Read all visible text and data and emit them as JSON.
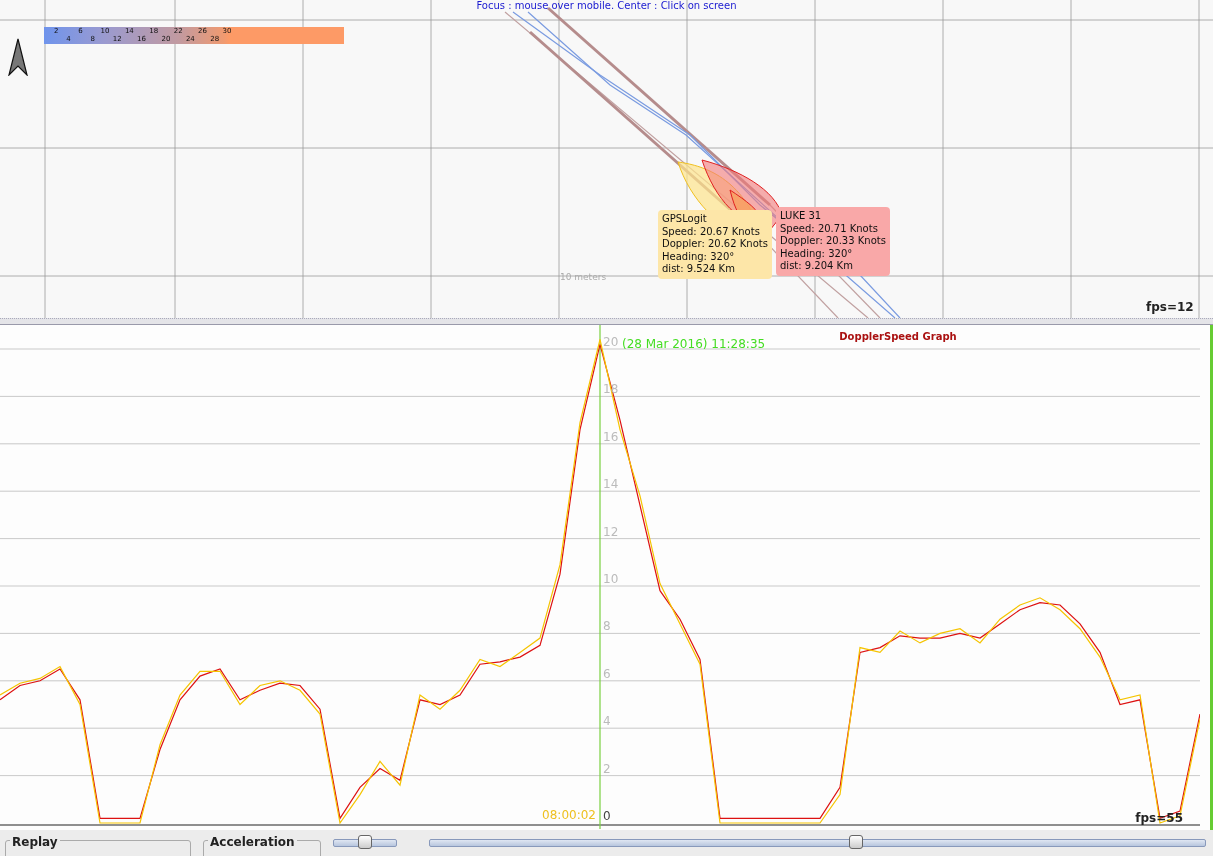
{
  "map": {
    "hint": "Focus : mouse over mobile. Center : Click on screen",
    "legend": [
      "2",
      "4",
      "6",
      "8",
      "10",
      "12",
      "14",
      "16",
      "18",
      "20",
      "22",
      "24",
      "26",
      "28",
      "30"
    ],
    "scale_label": "10 meters",
    "fps": "fps=12",
    "popups": [
      {
        "color": "#fde6a8",
        "lines": [
          "GPSLogit",
          "Speed: 20.67 Knots",
          "Doppler: 20.62 Knots",
          "Heading: 320°",
          "dist: 9.524 Km"
        ]
      },
      {
        "color": "#f9a8a8",
        "lines": [
          "LUKE 31",
          "Speed: 20.71 Knots",
          "Doppler: 20.33 Knots",
          "Heading: 320°",
          "dist: 9.204 Km"
        ]
      }
    ]
  },
  "graph": {
    "fps": "fps=55",
    "cursor_time": "(28 Mar 2016) 11:28:35",
    "cursor_start": "08:00:02",
    "chart_data": {
      "type": "line",
      "title": "DopplerSpeed Graph",
      "grid": true,
      "ylim": [
        0,
        21
      ],
      "yticks": [
        0,
        2,
        4,
        6,
        8,
        10,
        12,
        14,
        16,
        18,
        20
      ],
      "series": [
        {
          "color": "#dd1111",
          "values": [
            5.2,
            5.8,
            6.0,
            6.5,
            5.2,
            0.2,
            0.2,
            0.2,
            3.1,
            5.2,
            6.2,
            6.5,
            5.2,
            5.6,
            5.9,
            5.8,
            4.8,
            0.2,
            1.5,
            2.3,
            1.8,
            5.2,
            5.0,
            5.4,
            6.7,
            6.8,
            7.0,
            7.5,
            10.5,
            16.6,
            20.2,
            17.0,
            13.4,
            9.8,
            8.6,
            6.9,
            0.2,
            0.2,
            0.2,
            0.2,
            0.2,
            0.2,
            1.5,
            7.2,
            7.4,
            7.9,
            7.8,
            7.8,
            8.0,
            7.8,
            8.4,
            9.0,
            9.3,
            9.2,
            8.4,
            7.2,
            5.0,
            5.2,
            0.2,
            0.5,
            4.6
          ]
        },
        {
          "color": "#f5c400",
          "values": [
            5.4,
            5.9,
            6.1,
            6.6,
            5.0,
            0,
            0,
            0,
            3.3,
            5.4,
            6.4,
            6.4,
            5.0,
            5.8,
            6.0,
            5.6,
            4.6,
            0,
            1.2,
            2.6,
            1.6,
            5.4,
            4.8,
            5.6,
            6.9,
            6.6,
            7.2,
            7.8,
            10.9,
            16.9,
            20.4,
            16.6,
            13.8,
            10.1,
            8.4,
            6.7,
            0,
            0,
            0,
            0,
            0,
            0,
            1.2,
            7.4,
            7.2,
            8.1,
            7.6,
            8.0,
            8.2,
            7.6,
            8.6,
            9.2,
            9.5,
            9.0,
            8.2,
            7.0,
            5.2,
            5.4,
            0,
            0.3,
            4.4
          ]
        }
      ]
    }
  },
  "controls": {
    "replay": {
      "label": "Replay"
    },
    "acceleration": {
      "label": "Acceleration",
      "level": 0.5
    },
    "timeline": {
      "level": 0.55
    }
  }
}
